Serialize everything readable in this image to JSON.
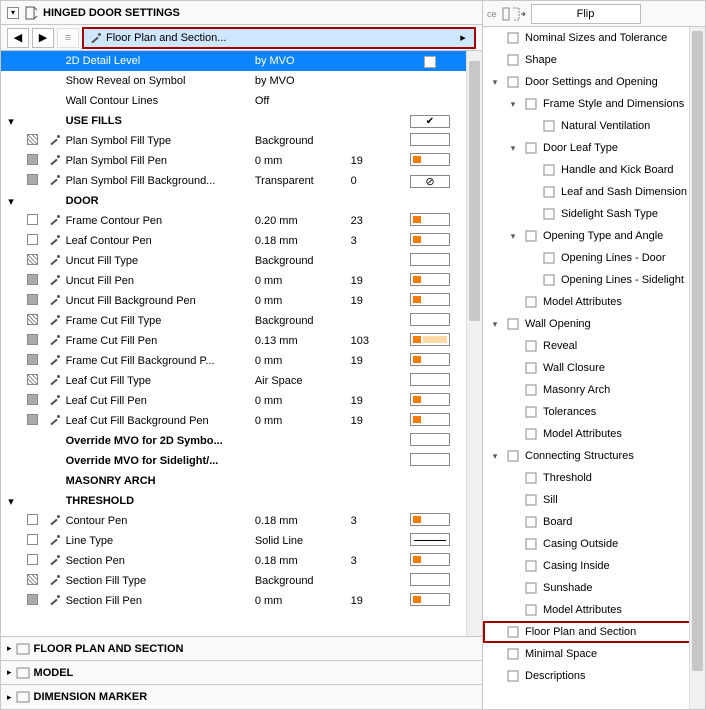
{
  "header": {
    "title": "HINGED DOOR SETTINGS"
  },
  "toolbar": {
    "dropdown_label": "Floor Plan and Section..."
  },
  "rows": [
    {
      "type": "selected",
      "name": "2D Detail Level",
      "val": "by MVO"
    },
    {
      "type": "plain",
      "name": "Show Reveal on Symbol",
      "val": "by MVO"
    },
    {
      "type": "plain",
      "name": "Wall Contour Lines",
      "val": "Off"
    },
    {
      "type": "group",
      "twist": "▾",
      "name": "USE FILLS",
      "ctrl": "check-checked"
    },
    {
      "type": "item",
      "i1": "hatch",
      "i2": "pen",
      "name": "Plan Symbol Fill Type",
      "val": "Background",
      "ctrl": "fill-blank"
    },
    {
      "type": "item",
      "i1": "gray",
      "i2": "pen",
      "name": "Plan Symbol Fill Pen",
      "val": "0 mm",
      "num": "19",
      "ctrl": "pen"
    },
    {
      "type": "item",
      "i1": "gray",
      "i2": "pen",
      "name": "Plan Symbol Fill Background...",
      "val": "Transparent",
      "num": "0",
      "ctrl": "trans"
    },
    {
      "type": "group",
      "twist": "▾",
      "name": "DOOR"
    },
    {
      "type": "item",
      "i1": "empty",
      "i2": "pen",
      "name": "Frame Contour Pen",
      "val": "0.20 mm",
      "num": "23",
      "ctrl": "pen"
    },
    {
      "type": "item",
      "i1": "empty",
      "i2": "pen",
      "name": "Leaf Contour Pen",
      "val": "0.18 mm",
      "num": "3",
      "ctrl": "pen"
    },
    {
      "type": "item",
      "i1": "hatch",
      "i2": "pen",
      "name": "Uncut Fill Type",
      "val": "Background",
      "ctrl": "fill-blank"
    },
    {
      "type": "item",
      "i1": "gray",
      "i2": "pen",
      "name": "Uncut Fill Pen",
      "val": "0 mm",
      "num": "19",
      "ctrl": "pen"
    },
    {
      "type": "item",
      "i1": "gray",
      "i2": "pen",
      "name": "Uncut Fill Background Pen",
      "val": "0 mm",
      "num": "19",
      "ctrl": "pen"
    },
    {
      "type": "item",
      "i1": "hatch",
      "i2": "pen",
      "name": "Frame Cut Fill Type",
      "val": "Background",
      "ctrl": "fill-blank"
    },
    {
      "type": "item",
      "i1": "gray",
      "i2": "pen",
      "name": "Frame Cut Fill Pen",
      "val": "0.13 mm",
      "num": "103",
      "ctrl": "pen-lite"
    },
    {
      "type": "item",
      "i1": "gray",
      "i2": "pen",
      "name": "Frame Cut Fill Background P...",
      "val": "0 mm",
      "num": "19",
      "ctrl": "pen"
    },
    {
      "type": "item",
      "i1": "hatch",
      "i2": "pen",
      "name": "Leaf Cut Fill Type",
      "val": "Air Space",
      "ctrl": "fill-blank"
    },
    {
      "type": "item",
      "i1": "gray",
      "i2": "pen",
      "name": "Leaf Cut Fill Pen",
      "val": "0 mm",
      "num": "19",
      "ctrl": "pen"
    },
    {
      "type": "item",
      "i1": "gray",
      "i2": "pen",
      "name": "Leaf Cut Fill Background Pen",
      "val": "0 mm",
      "num": "19",
      "ctrl": "pen"
    },
    {
      "type": "bold",
      "name": "Override MVO for 2D Symbo...",
      "ctrl": "check"
    },
    {
      "type": "bold",
      "name": "Override MVO for Sidelight/...",
      "ctrl": "check"
    },
    {
      "type": "group",
      "name": "MASONRY ARCH"
    },
    {
      "type": "group",
      "twist": "▾",
      "name": "THRESHOLD"
    },
    {
      "type": "item",
      "i1": "empty",
      "i2": "pen",
      "name": "Contour Pen",
      "val": "0.18 mm",
      "num": "3",
      "ctrl": "pen"
    },
    {
      "type": "item",
      "i1": "empty",
      "i2": "pen",
      "name": "Line Type",
      "val": "Solid Line",
      "ctrl": "line"
    },
    {
      "type": "item",
      "i1": "empty",
      "i2": "pen",
      "name": "Section Pen",
      "val": "0.18 mm",
      "num": "3",
      "ctrl": "pen"
    },
    {
      "type": "item",
      "i1": "hatch",
      "i2": "pen",
      "name": "Section Fill Type",
      "val": "Background",
      "ctrl": "fill-blank"
    },
    {
      "type": "item",
      "i1": "gray",
      "i2": "pen",
      "name": "Section Fill Pen",
      "val": "0 mm",
      "num": "19",
      "ctrl": "pen"
    }
  ],
  "bottom_panels": [
    {
      "label": "FLOOR PLAN AND SECTION"
    },
    {
      "label": "MODEL"
    },
    {
      "label": "DIMENSION MARKER"
    }
  ],
  "right": {
    "flip_label": "Flip",
    "nodes": [
      {
        "d": 0,
        "tw": "",
        "label": "Nominal Sizes and Tolerance"
      },
      {
        "d": 0,
        "tw": "",
        "label": "Shape"
      },
      {
        "d": 0,
        "tw": "▾",
        "label": "Door Settings and Opening"
      },
      {
        "d": 1,
        "tw": "▾",
        "label": "Frame Style and Dimensions"
      },
      {
        "d": 2,
        "tw": "",
        "label": "Natural Ventilation"
      },
      {
        "d": 1,
        "tw": "▾",
        "label": "Door Leaf Type"
      },
      {
        "d": 2,
        "tw": "",
        "label": "Handle and Kick Board"
      },
      {
        "d": 2,
        "tw": "",
        "label": "Leaf and Sash Dimension"
      },
      {
        "d": 2,
        "tw": "",
        "label": "Sidelight Sash Type"
      },
      {
        "d": 1,
        "tw": "▾",
        "label": "Opening Type and Angle"
      },
      {
        "d": 2,
        "tw": "",
        "label": "Opening Lines - Door"
      },
      {
        "d": 2,
        "tw": "",
        "label": "Opening Lines - Sidelight"
      },
      {
        "d": 1,
        "tw": "",
        "label": "Model Attributes"
      },
      {
        "d": 0,
        "tw": "▾",
        "label": "Wall Opening"
      },
      {
        "d": 1,
        "tw": "",
        "label": "Reveal"
      },
      {
        "d": 1,
        "tw": "",
        "label": "Wall Closure"
      },
      {
        "d": 1,
        "tw": "",
        "label": "Masonry Arch"
      },
      {
        "d": 1,
        "tw": "",
        "label": "Tolerances"
      },
      {
        "d": 1,
        "tw": "",
        "label": "Model Attributes"
      },
      {
        "d": 0,
        "tw": "▾",
        "label": "Connecting Structures"
      },
      {
        "d": 1,
        "tw": "",
        "label": "Threshold"
      },
      {
        "d": 1,
        "tw": "",
        "label": "Sill"
      },
      {
        "d": 1,
        "tw": "",
        "label": "Board"
      },
      {
        "d": 1,
        "tw": "",
        "label": "Casing Outside"
      },
      {
        "d": 1,
        "tw": "",
        "label": "Casing Inside"
      },
      {
        "d": 1,
        "tw": "",
        "label": "Sunshade"
      },
      {
        "d": 1,
        "tw": "",
        "label": "Model Attributes"
      },
      {
        "d": 0,
        "tw": "",
        "label": "Floor Plan and Section",
        "selected": true
      },
      {
        "d": 0,
        "tw": "",
        "label": "Minimal Space"
      },
      {
        "d": 0,
        "tw": "",
        "label": "Descriptions"
      }
    ]
  }
}
